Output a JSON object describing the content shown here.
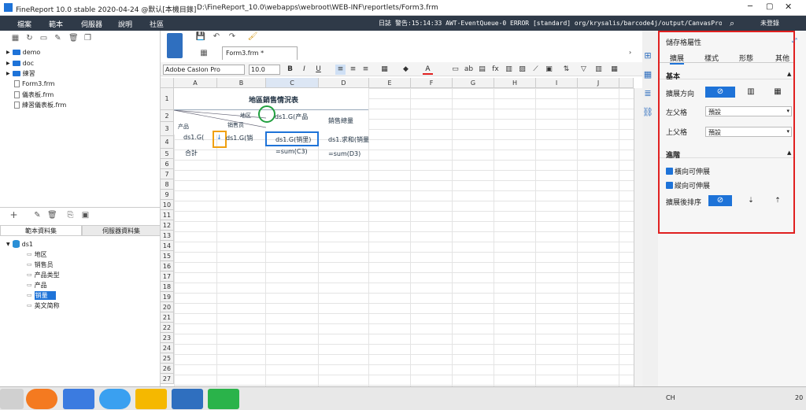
{
  "titlebar": {
    "app_title": "FineReport 10.0 stable 2020-04-24 @默认[本機目錄]",
    "path": "D:\\FineReport_10.0\\webapps\\webroot\\WEB-INF\\reportlets/Form3.frm"
  },
  "menu": [
    "檔案",
    "範本",
    "伺服器",
    "說明",
    "社區"
  ],
  "status": {
    "log": "日誌",
    "alert": "警告:15:14:33 AWT-EventQueue-0 ERROR [standard] org/krysalis/barcode4j/output/CanvasProvider",
    "login": "未登錄"
  },
  "file_tree": [
    {
      "label": "demo",
      "type": "folder"
    },
    {
      "label": "doc",
      "type": "folder"
    },
    {
      "label": "練習",
      "type": "folder"
    },
    {
      "label": "Form3.frm",
      "type": "file"
    },
    {
      "label": "儀表板.frm",
      "type": "file"
    },
    {
      "label": "練習儀表板.frm",
      "type": "file"
    }
  ],
  "dataset_tabs": [
    "範本資料集",
    "伺服器資料集"
  ],
  "dataset": {
    "name": "ds1",
    "fields": [
      "地区",
      "销售员",
      "产品类型",
      "产品",
      "销量",
      "英文简称"
    ],
    "selected": "销量"
  },
  "editor": {
    "tab": "Form3.frm *",
    "font": "Adobe Caslon Pro",
    "size": "10.0"
  },
  "columns": [
    "A",
    "B",
    "C",
    "D",
    "E",
    "F",
    "G",
    "H",
    "I",
    "J"
  ],
  "rows": [
    "1",
    "2",
    "3",
    "4",
    "5",
    "6",
    "7",
    "8",
    "9",
    "10",
    "11",
    "12",
    "13",
    "14",
    "15",
    "16",
    "17",
    "18",
    "19",
    "20",
    "21",
    "22",
    "23",
    "24",
    "25",
    "26",
    "27",
    "28"
  ],
  "cells": {
    "title": "地區銷售情況表",
    "a2_region": "地区",
    "a2_seller": "销售员",
    "a2_product": "产品",
    "c2": "ds1.G(产品",
    "d2": "銷售總量",
    "a3": "ds1.G(",
    "b3": "ds1.G(销",
    "c3": "ds1.G(销里)",
    "d3": "ds1.求和(销量",
    "a4": "合計",
    "c4": "=sum(C3)",
    "d4": "=sum(D3)"
  },
  "panel": {
    "title": "儲存格屬性",
    "tabs": [
      "擴展",
      "樣式",
      "形態",
      "其他"
    ],
    "basic_section": "基本",
    "expand_direction_label": "擴展方向",
    "left_parent_label": "左父格",
    "left_parent_value": "預設",
    "up_parent_label": "上父格",
    "up_parent_value": "預設",
    "advanced_section": "進階",
    "horizontal_expand": "橫向可伸展",
    "vertical_expand": "縱向可伸展",
    "sort_label": "擴展後排序"
  },
  "tray": {
    "lang": "CH",
    "year": "20"
  },
  "colors": {
    "accent": "#1e73d8",
    "highlight": "#e02020",
    "menubar": "#2f3a48"
  }
}
